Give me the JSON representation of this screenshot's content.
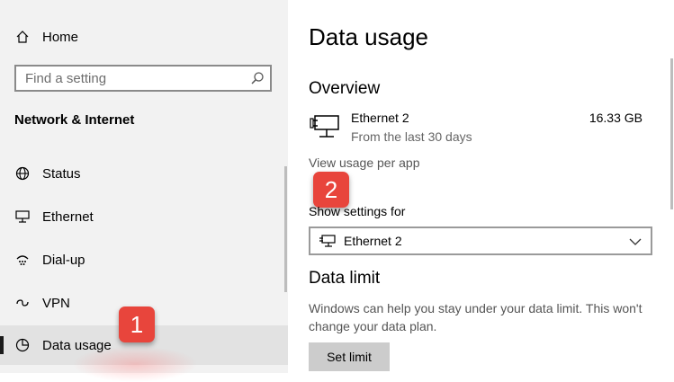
{
  "sidebar": {
    "home_label": "Home",
    "search_placeholder": "Find a setting",
    "section_title": "Network & Internet",
    "items": [
      {
        "label": "Status",
        "icon": "globe-icon"
      },
      {
        "label": "Ethernet",
        "icon": "ethernet-icon"
      },
      {
        "label": "Dial-up",
        "icon": "dial-up-icon"
      },
      {
        "label": "VPN",
        "icon": "vpn-icon"
      },
      {
        "label": "Data usage",
        "icon": "data-usage-icon",
        "selected": true
      }
    ]
  },
  "markers": {
    "one": "1",
    "two": "2",
    "color": "#e8453c"
  },
  "main": {
    "title": "Data usage",
    "overview_heading": "Overview",
    "connection_name": "Ethernet 2",
    "connection_sub": "From the last 30 days",
    "connection_size": "16.33 GB",
    "view_link": "View usage per app",
    "show_settings_label": "Show settings for",
    "dropdown_value": "Ethernet 2",
    "data_limit_heading": "Data limit",
    "data_limit_desc": "Windows can help you stay under your data limit. This won't change your data plan.",
    "set_limit_label": "Set limit"
  }
}
